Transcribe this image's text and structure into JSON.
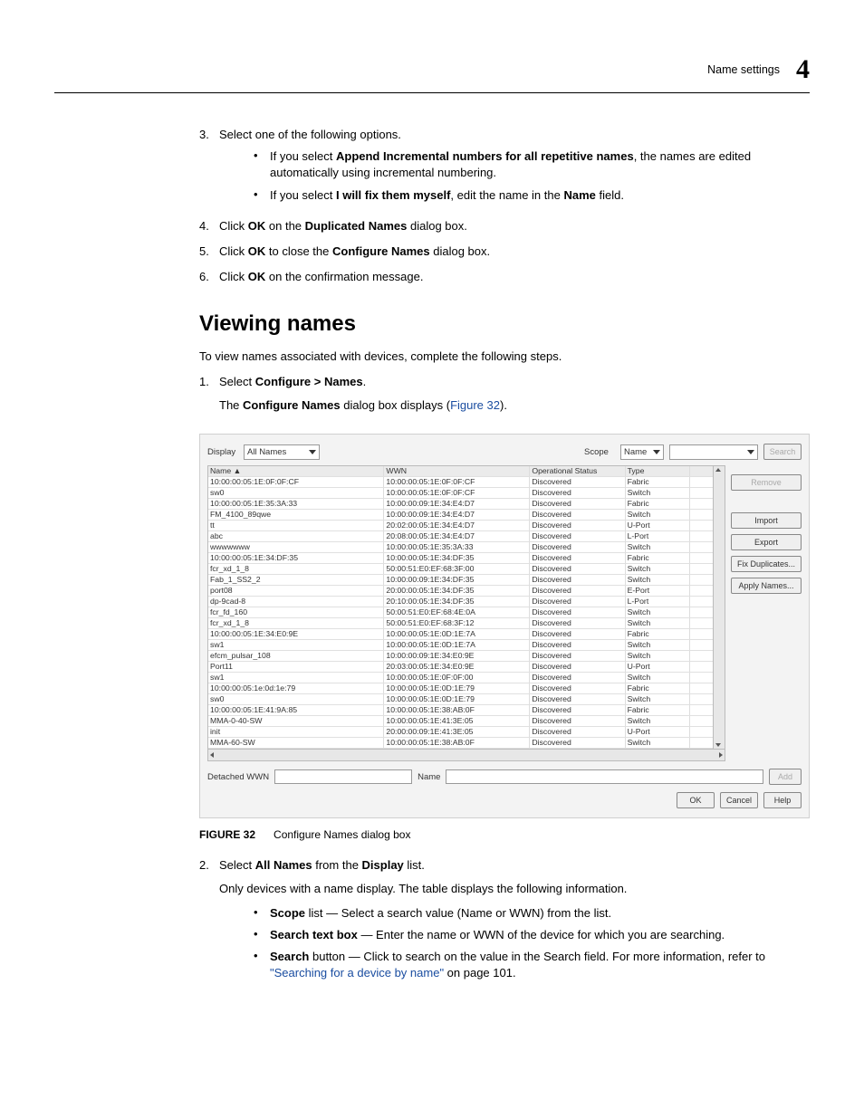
{
  "header": {
    "section_label": "Name settings",
    "chapter_no": "4"
  },
  "first_list": {
    "start": 3,
    "items": [
      {
        "marker": "3.",
        "line": "Select one of the following options.",
        "subs": [
          {
            "pre": "If you select ",
            "bold": "Append Incremental numbers for all repetitive names",
            "post": ", the names are edited automatically using incremental numbering."
          },
          {
            "pre": "If you select ",
            "bold": "I will fix them myself",
            "mid": ", edit the name in the ",
            "bold2": "Name",
            "post": " field."
          }
        ]
      },
      {
        "marker": "4.",
        "parts": [
          {
            "t": "Click "
          },
          {
            "t": "OK",
            "b": true
          },
          {
            "t": " on the "
          },
          {
            "t": "Duplicated Names",
            "b": true
          },
          {
            "t": " dialog box."
          }
        ]
      },
      {
        "marker": "5.",
        "parts": [
          {
            "t": "Click "
          },
          {
            "t": "OK",
            "b": true
          },
          {
            "t": " to close the "
          },
          {
            "t": "Configure Names",
            "b": true
          },
          {
            "t": " dialog box."
          }
        ]
      },
      {
        "marker": "6.",
        "parts": [
          {
            "t": "Click "
          },
          {
            "t": "OK",
            "b": true
          },
          {
            "t": " on the confirmation message."
          }
        ]
      }
    ]
  },
  "main_heading": "Viewing names",
  "intro_para": "To view names associated with devices, complete the following steps.",
  "second_list": {
    "items": [
      {
        "marker": "1.",
        "parts": [
          {
            "t": "Select "
          },
          {
            "t": "Configure > Names",
            "b": true
          },
          {
            "t": "."
          }
        ],
        "sub_para": {
          "pre": "The ",
          "bold": "Configure Names",
          "mid": " dialog box displays (",
          "link": "Figure 32",
          "post": ")."
        }
      }
    ]
  },
  "dialog": {
    "display_label": "Display",
    "display_value": "All Names",
    "scope_label": "Scope",
    "scope_value": "Name",
    "search_btn": "Search",
    "headers": {
      "name": "Name ▲",
      "wwn": "WWN",
      "op": "Operational Status",
      "type": "Type"
    },
    "rows": [
      {
        "name": "10:00:00:05:1E:0F:0F:CF",
        "wwn": "10:00:00:05:1E:0F:0F:CF",
        "op": "Discovered",
        "type": "Fabric"
      },
      {
        "name": "sw0",
        "wwn": "10:00:00:05:1E:0F:0F:CF",
        "op": "Discovered",
        "type": "Switch"
      },
      {
        "name": "10:00:00:05:1E:35:3A:33",
        "wwn": "10:00:00:09:1E:34:E4:D7",
        "op": "Discovered",
        "type": "Fabric"
      },
      {
        "name": "FM_4100_89qwe",
        "wwn": "10:00:00:09:1E:34:E4:D7",
        "op": "Discovered",
        "type": "Switch"
      },
      {
        "name": "tt",
        "wwn": "20:02:00:05:1E:34:E4:D7",
        "op": "Discovered",
        "type": "U-Port"
      },
      {
        "name": "abc",
        "wwn": "20:08:00:05:1E:34:E4:D7",
        "op": "Discovered",
        "type": "L-Port"
      },
      {
        "name": "wwwwwww",
        "wwn": "10:00:00:05:1E:35:3A:33",
        "op": "Discovered",
        "type": "Switch"
      },
      {
        "name": "10:00:00:05:1E:34:DF:35",
        "wwn": "10:00:00:05:1E:34:DF:35",
        "op": "Discovered",
        "type": "Fabric"
      },
      {
        "name": "fcr_xd_1_8",
        "wwn": "50:00:51:E0:EF:68:3F:00",
        "op": "Discovered",
        "type": "Switch"
      },
      {
        "name": "Fab_1_SS2_2",
        "wwn": "10:00:00:09:1E:34:DF:35",
        "op": "Discovered",
        "type": "Switch"
      },
      {
        "name": "port08",
        "wwn": "20:00:00:05:1E:34:DF:35",
        "op": "Discovered",
        "type": "E-Port"
      },
      {
        "name": "dp-9cad-8",
        "wwn": "20:10:00:05:1E:34:DF:35",
        "op": "Discovered",
        "type": "L-Port"
      },
      {
        "name": "fcr_fd_160",
        "wwn": "50:00:51:E0:EF:68:4E:0A",
        "op": "Discovered",
        "type": "Switch"
      },
      {
        "name": "fcr_xd_1_8",
        "wwn": "50:00:51:E0:EF:68:3F:12",
        "op": "Discovered",
        "type": "Switch"
      },
      {
        "name": "10:00:00:05:1E:34:E0:9E",
        "wwn": "10:00:00:05:1E:0D:1E:7A",
        "op": "Discovered",
        "type": "Fabric"
      },
      {
        "name": "sw1",
        "wwn": "10:00:00:05:1E:0D:1E:7A",
        "op": "Discovered",
        "type": "Switch"
      },
      {
        "name": "efcm_pulsar_108",
        "wwn": "10:00:00:09:1E:34:E0:9E",
        "op": "Discovered",
        "type": "Switch"
      },
      {
        "name": "Port11",
        "wwn": "20:03:00:05:1E:34:E0:9E",
        "op": "Discovered",
        "type": "U-Port"
      },
      {
        "name": "sw1",
        "wwn": "10:00:00:05:1E:0F:0F:00",
        "op": "Discovered",
        "type": "Switch"
      },
      {
        "name": "10:00:00:05:1e:0d:1e:79",
        "wwn": "10:00:00:05:1E:0D:1E:79",
        "op": "Discovered",
        "type": "Fabric"
      },
      {
        "name": "sw0",
        "wwn": "10:00:00:05:1E:0D:1E:79",
        "op": "Discovered",
        "type": "Switch"
      },
      {
        "name": "10:00:00:05:1E:41:9A:85",
        "wwn": "10:00:00:05:1E:38:AB:0F",
        "op": "Discovered",
        "type": "Fabric"
      },
      {
        "name": "MMA-0-40-SW",
        "wwn": "10:00:00:05:1E:41:3E:05",
        "op": "Discovered",
        "type": "Switch"
      },
      {
        "name": "init",
        "wwn": "20:00:00:09:1E:41:3E:05",
        "op": "Discovered",
        "type": "U-Port"
      },
      {
        "name": "MMA-60-SW",
        "wwn": "10:00:00:05:1E:38:AB:0F",
        "op": "Discovered",
        "type": "Switch"
      }
    ],
    "sidebar_buttons": [
      "Remove",
      "Import",
      "Export",
      "Fix Duplicates...",
      "Apply Names..."
    ],
    "detached_label": "Detached WWN",
    "name_label": "Name",
    "add_btn": "Add",
    "ok": "OK",
    "cancel": "Cancel",
    "help": "Help"
  },
  "figure": {
    "label": "FIGURE 32",
    "caption": "Configure Names dialog box"
  },
  "after_fig": {
    "items": [
      {
        "marker": "2.",
        "parts": [
          {
            "t": "Select "
          },
          {
            "t": "All Names",
            "b": true
          },
          {
            "t": " from the "
          },
          {
            "t": "Display",
            "b": true
          },
          {
            "t": " list."
          }
        ],
        "sub_para_plain": "Only devices with a name display. The table displays the following information.",
        "bullets": [
          {
            "bold": "Scope",
            "rest": " list — Select a search value (Name or WWN) from the list."
          },
          {
            "bold": "Search text box",
            "rest": " — Enter the name or WWN of the device for which you are searching."
          },
          {
            "bold": "Search",
            "rest_pre": " button — Click to search on the value in the Search field. For more information, refer to ",
            "link": "\"Searching for a device by name\"",
            "rest_post": " on page 101."
          }
        ]
      }
    ]
  }
}
